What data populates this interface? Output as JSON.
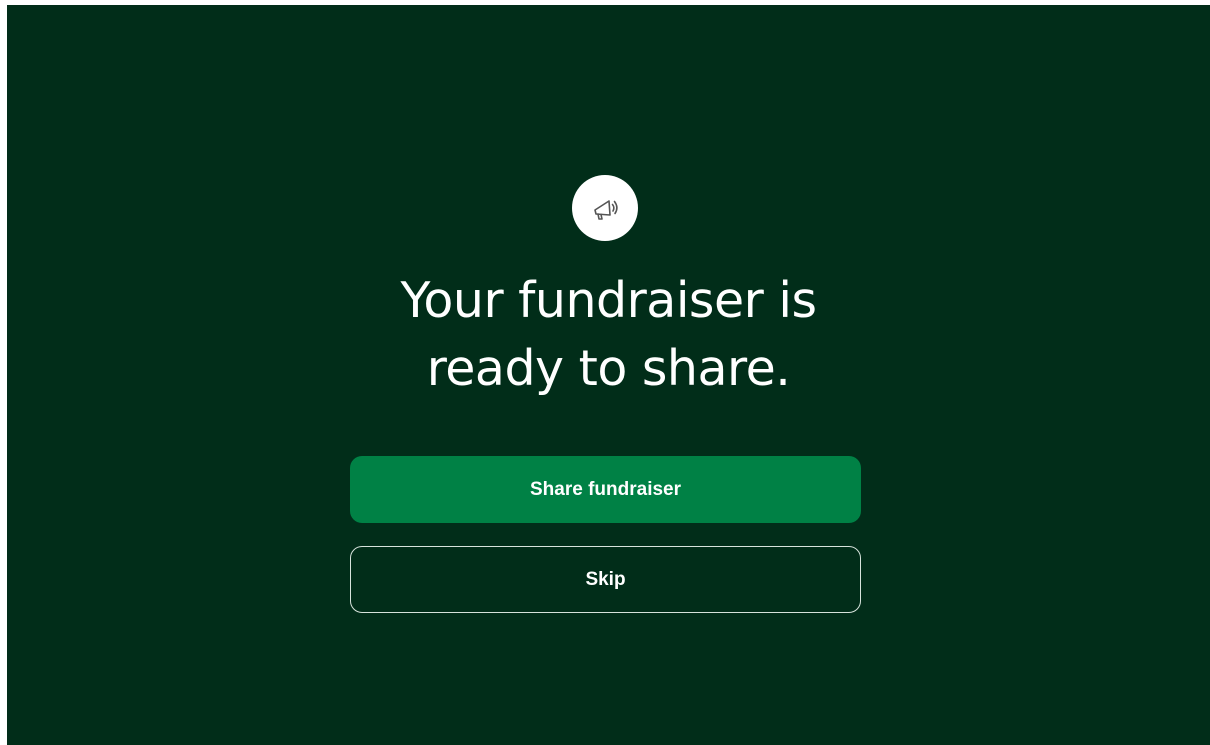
{
  "colors": {
    "background": "#012d19",
    "primary_button": "#008145",
    "text": "#ffffff",
    "icon_circle": "#ffffff",
    "icon_stroke": "#555555"
  },
  "hero": {
    "icon": "megaphone-icon",
    "headline_line1": "Your fundraiser is",
    "headline_line2": "ready to share."
  },
  "actions": {
    "share_label": "Share fundraiser",
    "skip_label": "Skip"
  }
}
